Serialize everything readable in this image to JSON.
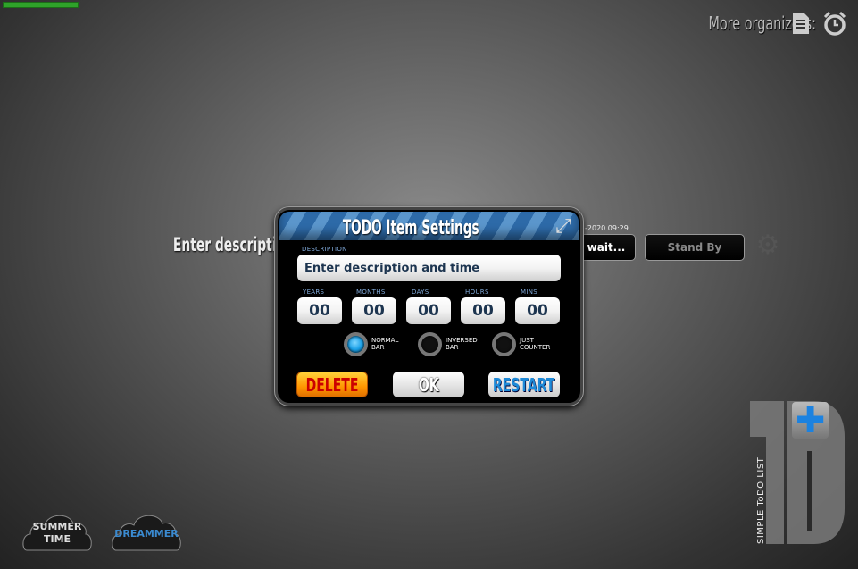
{
  "header": {
    "more_label": "More organizers:",
    "icons": [
      "document-icon",
      "alarm-clock-icon"
    ]
  },
  "progress": {
    "color": "#2fa22a"
  },
  "background_item": {
    "description": "Enter description and time",
    "date": "-2020 09:29",
    "wait_label": "wait...",
    "status_label": "Stand By"
  },
  "dialog": {
    "title": "TODO Item Settings",
    "description_label": "DESCRIPTION",
    "description_value": "Enter description and time",
    "fields": [
      {
        "label": "YEARS",
        "value": "00"
      },
      {
        "label": "MONTHS",
        "value": "00"
      },
      {
        "label": "DAYS",
        "value": "00"
      },
      {
        "label": "HOURS",
        "value": "00"
      },
      {
        "label": "MINS",
        "value": "00"
      }
    ],
    "modes": [
      {
        "label1": "NORMAL",
        "label2": "BAR",
        "selected": true
      },
      {
        "label1": "INVERSED",
        "label2": "BAR",
        "selected": false
      },
      {
        "label1": "JUST",
        "label2": "COUNTER",
        "selected": false
      }
    ],
    "delete_label": "DELETE",
    "ok_label": "OK",
    "restart_label": "RESTART"
  },
  "logo": {
    "text": "1D",
    "tagline": "SIMPLE   ToDO LIST"
  },
  "themes": [
    {
      "line1": "SUMMER",
      "line2": "TIME",
      "color": "#dddddd"
    },
    {
      "line1": "DREAMMER",
      "line2": "",
      "color": "#3a8ad0"
    }
  ]
}
